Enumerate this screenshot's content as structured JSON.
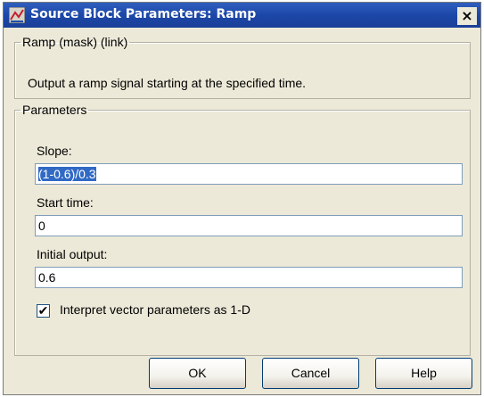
{
  "window": {
    "title": "Source Block Parameters: Ramp",
    "close_glyph": "×",
    "icon": "simulink-block-icon"
  },
  "mask_group": {
    "legend": "Ramp (mask) (link)",
    "description": "Output a ramp signal starting at the specified time."
  },
  "params_group": {
    "legend": "Parameters",
    "slope": {
      "label": "Slope:",
      "value": "(1-0.6)/0.3"
    },
    "start_time": {
      "label": "Start time:",
      "value": "0"
    },
    "initial_output": {
      "label": "Initial output:",
      "value": "0.6"
    },
    "interpret_vector": {
      "label": "Interpret vector parameters as 1-D",
      "checked": true,
      "check_glyph": "✔"
    }
  },
  "buttons": {
    "ok": "OK",
    "cancel": "Cancel",
    "help": "Help"
  }
}
